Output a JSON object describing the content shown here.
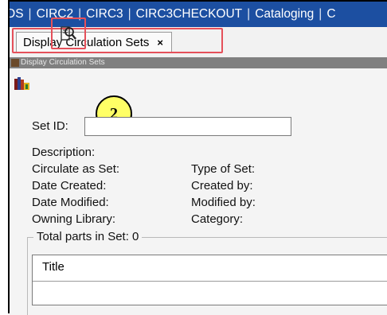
{
  "tabbar": {
    "partial_first": "DS",
    "tabs": [
      "CIRC2",
      "CIRC3",
      "CIRC3CHECKOUT",
      "Cataloging",
      "C"
    ]
  },
  "doc_tab": {
    "label": "Display Circulation Sets",
    "close": "×"
  },
  "window_title": "Display Circulation Sets",
  "badge": "2",
  "form": {
    "set_id_label": "Set ID:",
    "description_label": "Description:",
    "circulate_as_set_label": "Circulate as Set:",
    "type_of_set_label": "Type of Set:",
    "date_created_label": "Date Created:",
    "created_by_label": "Created by:",
    "date_modified_label": "Date Modified:",
    "modified_by_label": "Modified by:",
    "owning_library_label": "Owning Library:",
    "category_label": "Category:"
  },
  "parts_group": {
    "legend": "Total parts in Set: 0",
    "column_header": "Title"
  },
  "colors": {
    "tabbar_bg": "#1c4fa1",
    "callout_red": "#e5505a",
    "badge_yellow": "#ffff66"
  }
}
